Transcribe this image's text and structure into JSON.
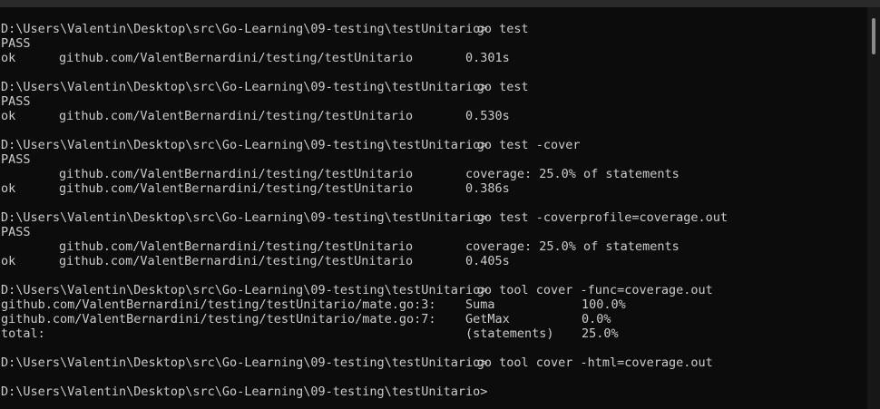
{
  "prompt": "D:\\Users\\Valentin\\Desktop\\src\\Go-Learning\\09-testing\\testUnitario>",
  "lines": [
    {
      "type": "cmd",
      "cmd": "go test"
    },
    {
      "type": "text",
      "text": "PASS"
    },
    {
      "type": "cols",
      "a": "ok",
      "b": "github.com/ValentBernardini/testing/testUnitario",
      "c": "0.301s"
    },
    {
      "type": "blank"
    },
    {
      "type": "cmd",
      "cmd": "go test"
    },
    {
      "type": "text",
      "text": "PASS"
    },
    {
      "type": "cols",
      "a": "ok",
      "b": "github.com/ValentBernardini/testing/testUnitario",
      "c": "0.530s"
    },
    {
      "type": "blank"
    },
    {
      "type": "cmd",
      "cmd": "go test -cover"
    },
    {
      "type": "text",
      "text": "PASS"
    },
    {
      "type": "cols",
      "a": "",
      "b": "github.com/ValentBernardini/testing/testUnitario",
      "c": "coverage: 25.0% of statements"
    },
    {
      "type": "cols",
      "a": "ok",
      "b": "github.com/ValentBernardini/testing/testUnitario",
      "c": "0.386s"
    },
    {
      "type": "blank"
    },
    {
      "type": "cmd",
      "cmd": "go test -coverprofile=coverage.out"
    },
    {
      "type": "text",
      "text": "PASS"
    },
    {
      "type": "cols",
      "a": "",
      "b": "github.com/ValentBernardini/testing/testUnitario",
      "c": "coverage: 25.0% of statements"
    },
    {
      "type": "cols",
      "a": "ok",
      "b": "github.com/ValentBernardini/testing/testUnitario",
      "c": "0.405s"
    },
    {
      "type": "blank"
    },
    {
      "type": "cmd",
      "cmd": "go tool cover -func=coverage.out"
    },
    {
      "type": "func",
      "a": "github.com/ValentBernardini/testing/testUnitario/mate.go:3:",
      "b": "Suma",
      "c": "100.0%"
    },
    {
      "type": "func",
      "a": "github.com/ValentBernardini/testing/testUnitario/mate.go:7:",
      "b": "GetMax",
      "c": "0.0%"
    },
    {
      "type": "func",
      "a": "total:",
      "b": "(statements)",
      "c": "25.0%"
    },
    {
      "type": "blank"
    },
    {
      "type": "cmd",
      "cmd": "go tool cover -html=coverage.out"
    },
    {
      "type": "blank"
    },
    {
      "type": "cmd",
      "cmd": ""
    }
  ]
}
